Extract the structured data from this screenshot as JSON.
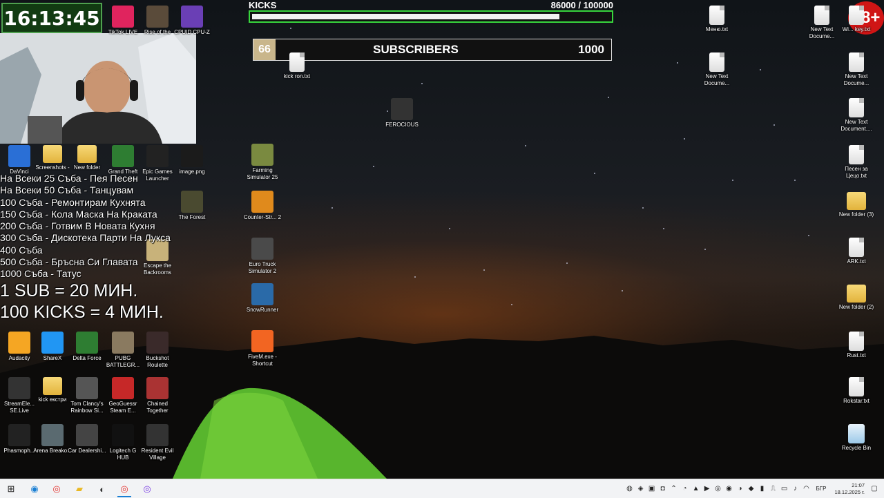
{
  "overlay_clock": {
    "time": "16:13:45"
  },
  "kicks_goal": {
    "label": "KICKS",
    "current": "86000",
    "target": "/ 100000",
    "progress_fraction": 0.86
  },
  "subs_goal": {
    "count": "66",
    "label": "SUBSCRIBERS",
    "target": "1000"
  },
  "age_badge": "18+",
  "overlay_text": {
    "lines": [
      "На Всеки 25 Съба - Пея Песен",
      "На Всеки 50 Съба - Танцувам",
      "100 Съба - Ремонтирам Кухнята",
      "150 Съба - Кола Маска На Краката",
      "200 Съба - Готвим В Новата Кухня",
      "300 Съба - Дискотека Парти На Лукса",
      "400 Съба",
      "500 Съба - Бръсна Си Главата",
      "1000 Съба - Татус"
    ],
    "rate_lines": [
      "1 SUB = 20 МИН.",
      "100 KICKS = 4 МИН."
    ]
  },
  "desktop_icons_left": [
    {
      "label": "TikTok LIVE",
      "icon": "tiktok-icon",
      "color": "#e0245e"
    },
    {
      "label": "Rise of the",
      "icon": "game-icon",
      "color": "#5a4b3a"
    },
    {
      "label": "CPUID CPU-Z",
      "icon": "cpuz-icon",
      "color": "#6a3fb5"
    },
    {
      "label": "DaVinci",
      "icon": "davinci-icon",
      "color": "#2a6fd6"
    },
    {
      "label": "Screenshots -",
      "icon": "folder-icon",
      "color": "#e9c24d"
    },
    {
      "label": "New folder",
      "icon": "folder-icon",
      "color": "#e9c24d"
    },
    {
      "label": "Grand Theft",
      "icon": "gta-icon",
      "color": "#2e7d32"
    },
    {
      "label": "Epic Games Launcher",
      "icon": "epic-icon",
      "color": "#222222"
    },
    {
      "label": "image.png",
      "icon": "image-icon",
      "color": "#1b1b1b"
    },
    {
      "label": "The Forest",
      "icon": "forest-icon",
      "color": "#4a4a30"
    },
    {
      "label": "Escape the Backrooms",
      "icon": "backrooms-icon",
      "color": "#c8b27a"
    },
    {
      "label": "Audacity",
      "icon": "audacity-icon",
      "color": "#f5a623"
    },
    {
      "label": "ShareX",
      "icon": "sharex-icon",
      "color": "#2196f3"
    },
    {
      "label": "Delta Force",
      "icon": "deltaforce-icon",
      "color": "#2e7d32"
    },
    {
      "label": "PUBG BATTLEGR...",
      "icon": "pubg-icon",
      "color": "#8a7a60"
    },
    {
      "label": "Buckshot Roulette",
      "icon": "buckshot-icon",
      "color": "#3a2a2a"
    },
    {
      "label": "StreamEle... SE.Live",
      "icon": "streamelements-icon",
      "color": "#333333"
    },
    {
      "label": "kick екстри",
      "icon": "folder-icon",
      "color": "#e9c24d"
    },
    {
      "label": "Tom Clancy's Rainbow Si...",
      "icon": "r6-icon",
      "color": "#555555"
    },
    {
      "label": "GeoGuessr Steam E...",
      "icon": "geoguessr-icon",
      "color": "#c62828"
    },
    {
      "label": "Chained Together",
      "icon": "chained-icon",
      "color": "#a33"
    },
    {
      "label": "Phasmoph...",
      "icon": "phasmo-icon",
      "color": "#222222"
    },
    {
      "label": "Arena Breako...",
      "icon": "arena-icon",
      "color": "#5a6a70"
    },
    {
      "label": "Car Dealershi...",
      "icon": "car-icon",
      "color": "#444444"
    },
    {
      "label": "Logitech G HUB",
      "icon": "logitech-icon",
      "color": "#111111"
    },
    {
      "label": "Resident Evil Village",
      "icon": "re-icon",
      "color": "#333333"
    }
  ],
  "desktop_icons_mid": [
    {
      "label": "kick ron.txt",
      "icon": "document-icon"
    },
    {
      "label": "FEROCIOUS",
      "icon": "ferocious-icon"
    },
    {
      "label": "Farming Simulator 25",
      "icon": "farming-icon"
    },
    {
      "label": "Counter-Str... 2",
      "icon": "cs2-icon"
    },
    {
      "label": "Euro Truck Simulator 2",
      "icon": "ets2-icon"
    },
    {
      "label": "SnowRunner",
      "icon": "snowrunner-icon"
    },
    {
      "label": "FiveM.exe - Shortcut",
      "icon": "fivem-icon"
    }
  ],
  "desktop_icons_right": [
    {
      "label": "Меню.txt",
      "icon": "document-icon"
    },
    {
      "label": "New Text Docume...",
      "icon": "document-icon"
    },
    {
      "label": "Wi... key.txt",
      "icon": "document-icon"
    },
    {
      "label": "New Text Docume...",
      "icon": "document-icon"
    },
    {
      "label": "New Text Docume...",
      "icon": "document-icon"
    },
    {
      "label": "New Text Document....",
      "icon": "document-icon"
    },
    {
      "label": "Песен за Цецо.txt",
      "icon": "document-icon"
    },
    {
      "label": "New folder (3)",
      "icon": "folder-icon"
    },
    {
      "label": "ARK.txt",
      "icon": "document-icon"
    },
    {
      "label": "New folder (2)",
      "icon": "folder-icon"
    },
    {
      "label": "Rust.txt",
      "icon": "document-icon"
    },
    {
      "label": "Rokstar.txt",
      "icon": "document-icon"
    },
    {
      "label": "Recycle Bin",
      "icon": "recycle-bin-icon"
    }
  ],
  "taskbar": {
    "apps": [
      "windows-start-icon",
      "edge-icon",
      "chrome-icon",
      "file-explorer-icon",
      "obs-icon",
      "chrome-icon",
      "chrome-alt-icon"
    ],
    "language": "БГР",
    "time": "21:07",
    "date": "18.12.2025 г."
  }
}
